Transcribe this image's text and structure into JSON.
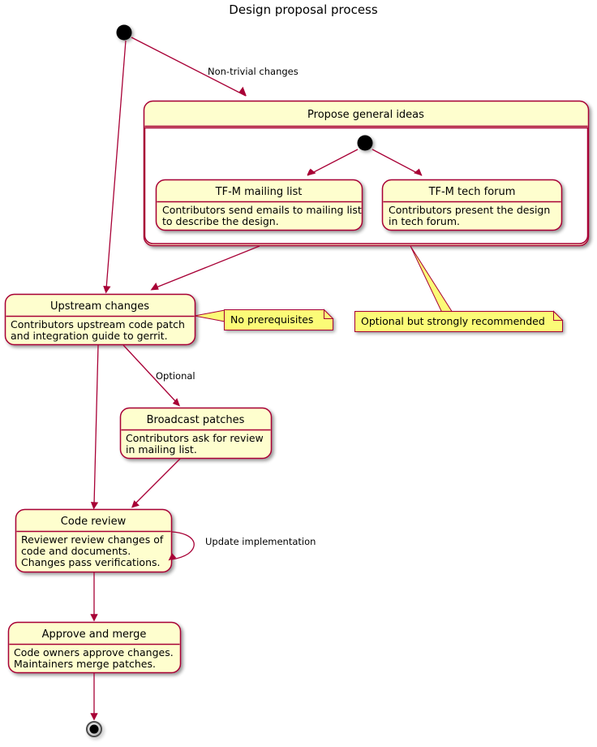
{
  "title": "Design proposal process",
  "colors": {
    "state_fill": "#FEFECE",
    "state_border": "#A80036",
    "note_fill": "#FBFB77",
    "arrow": "#A80036",
    "inner_fill": "#FFFFFF",
    "text": "#000000"
  },
  "nodes": {
    "start": {
      "name": "start-node"
    },
    "propose": {
      "title": "Propose general ideas",
      "inner_start": {
        "name": "inner-start-node"
      }
    },
    "mailing_list": {
      "title": "TF-M mailing list",
      "body_line1": "Contributors send emails to mailing list",
      "body_line2": "to describe the design."
    },
    "tech_forum": {
      "title": "TF-M tech forum",
      "body_line1": "Contributors present the design",
      "body_line2": "in tech forum."
    },
    "upstream": {
      "title": "Upstream changes",
      "body_line1": "Contributors upstream code patch",
      "body_line2": "and integration guide to gerrit."
    },
    "broadcast": {
      "title": "Broadcast patches",
      "body_line1": "Contributors ask for review",
      "body_line2": "in mailing list."
    },
    "code_review": {
      "title": "Code review",
      "body_line1": "Reviewer review changes of",
      "body_line2": "code and documents.",
      "body_line3": "Changes pass verifications."
    },
    "approve": {
      "title": "Approve and merge",
      "body_line1": "Code owners approve changes.",
      "body_line2": "Maintainers merge patches."
    },
    "end": {
      "name": "end-node"
    }
  },
  "edges": {
    "start_to_propose": "Non-trivial changes",
    "upstream_to_broadcast": "Optional",
    "code_review_self": "Update implementation"
  },
  "notes": {
    "no_prereq": "No prerequisites",
    "optional_recommended": "Optional but strongly recommended"
  }
}
